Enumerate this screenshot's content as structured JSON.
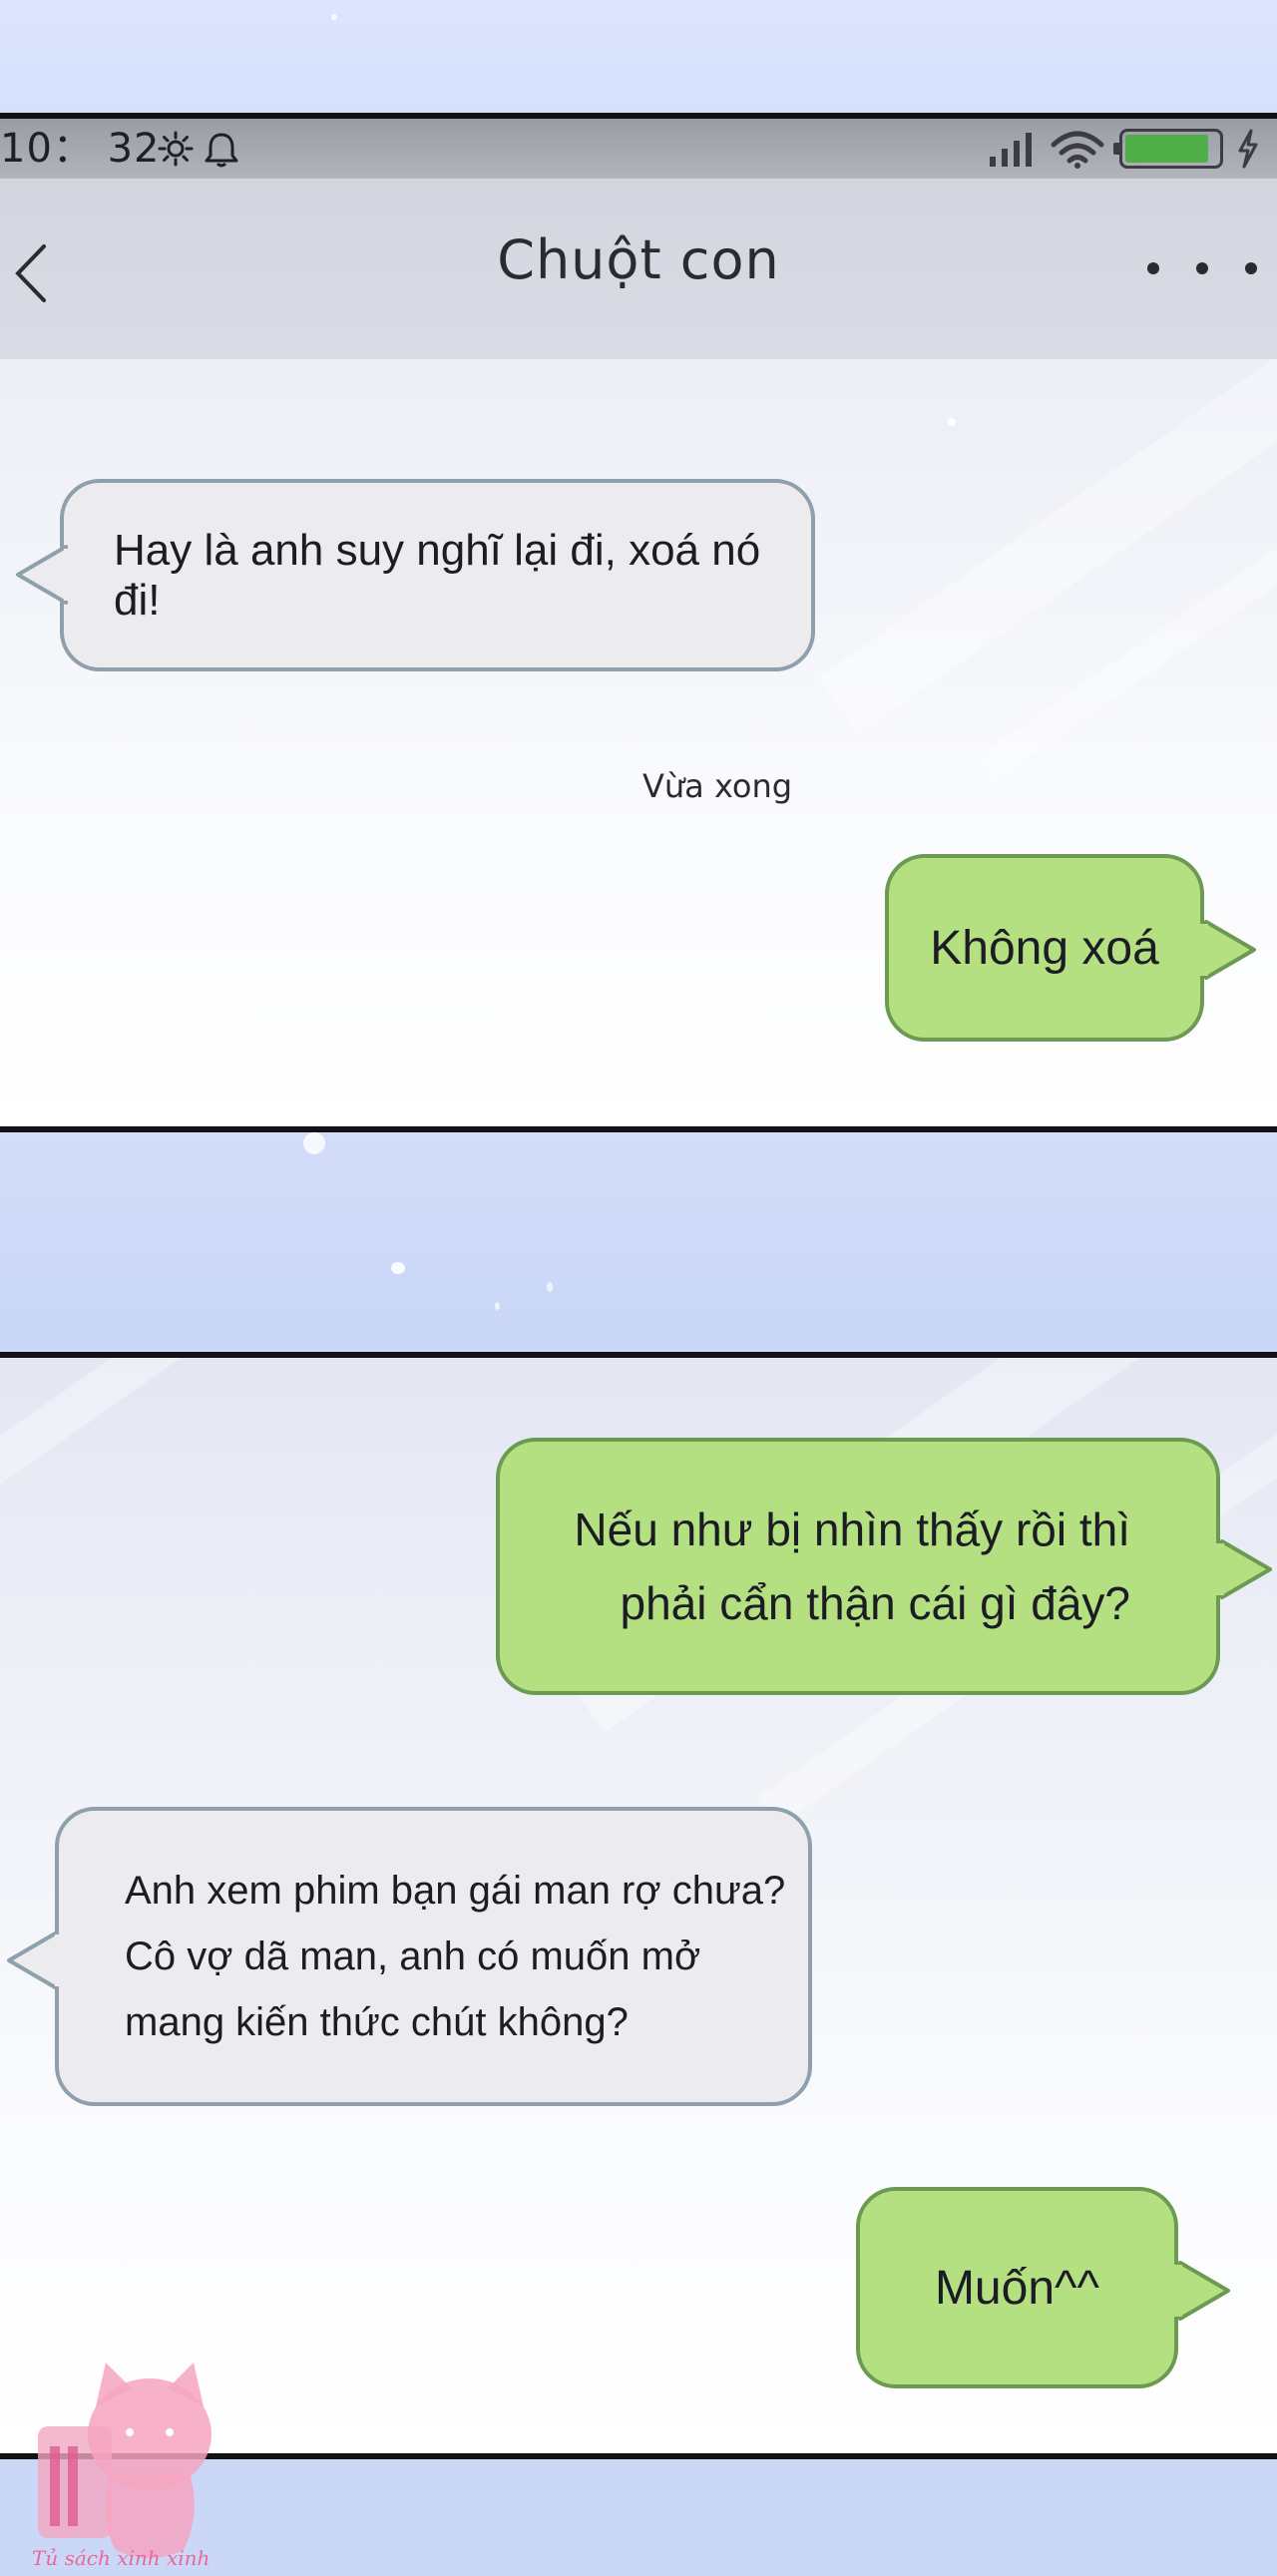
{
  "status_bar": {
    "time": "10： 32",
    "icons_left": [
      "brightness-icon",
      "alarm-icon"
    ],
    "icons_right": [
      "signal-icon",
      "wifi-icon",
      "battery-icon",
      "charging-icon"
    ],
    "battery_level_fraction": 0.9
  },
  "nav": {
    "title": "Chuột con",
    "back_icon": "chevron-left-icon",
    "more_icon": "more-horizontal-icon"
  },
  "messages_panel_1": [
    {
      "side": "received",
      "text": "Hay là anh suy nghĩ lại đi, xoá nó đi!"
    },
    {
      "side": "sent",
      "text": "Không xoá"
    }
  ],
  "timestamp": "Vừa xong",
  "messages_panel_2": [
    {
      "side": "sent",
      "text": "Nếu như bị nhìn thấy rồi thì\nphải cẩn thận cái gì đây?"
    },
    {
      "side": "received",
      "text": "Anh xem phim bạn gái man rợ chưa?\nCô vợ dã man, anh có muốn mở\nmang kiến thức chút không?"
    },
    {
      "side": "sent",
      "text": "Muốn^^"
    }
  ],
  "watermark": {
    "text": "Tủ sách xinh xinh"
  },
  "colors": {
    "sent_bubble": "#b4e081",
    "received_bubble": "#ececef",
    "page_background": "#d7e1fb",
    "battery": "#4fae48",
    "watermark": "#e9689a"
  }
}
